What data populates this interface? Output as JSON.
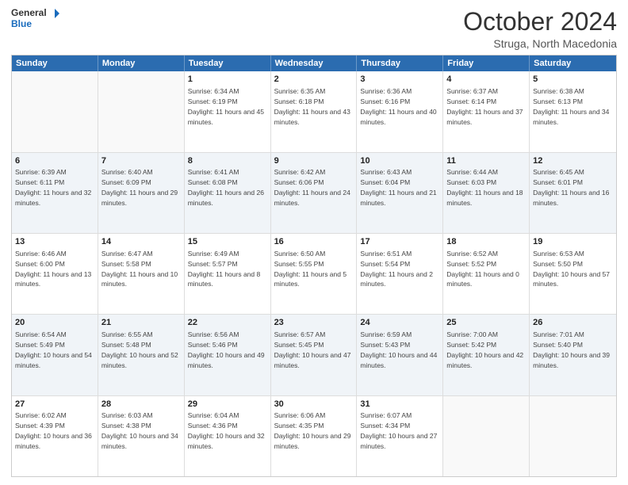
{
  "header": {
    "logo": {
      "general": "General",
      "blue": "Blue"
    },
    "title": "October 2024",
    "location": "Struga, North Macedonia"
  },
  "calendar": {
    "days": [
      "Sunday",
      "Monday",
      "Tuesday",
      "Wednesday",
      "Thursday",
      "Friday",
      "Saturday"
    ],
    "rows": [
      [
        {
          "day": "",
          "empty": true
        },
        {
          "day": "",
          "empty": true
        },
        {
          "day": "1",
          "sunrise": "Sunrise: 6:34 AM",
          "sunset": "Sunset: 6:19 PM",
          "daylight": "Daylight: 11 hours and 45 minutes."
        },
        {
          "day": "2",
          "sunrise": "Sunrise: 6:35 AM",
          "sunset": "Sunset: 6:18 PM",
          "daylight": "Daylight: 11 hours and 43 minutes."
        },
        {
          "day": "3",
          "sunrise": "Sunrise: 6:36 AM",
          "sunset": "Sunset: 6:16 PM",
          "daylight": "Daylight: 11 hours and 40 minutes."
        },
        {
          "day": "4",
          "sunrise": "Sunrise: 6:37 AM",
          "sunset": "Sunset: 6:14 PM",
          "daylight": "Daylight: 11 hours and 37 minutes."
        },
        {
          "day": "5",
          "sunrise": "Sunrise: 6:38 AM",
          "sunset": "Sunset: 6:13 PM",
          "daylight": "Daylight: 11 hours and 34 minutes."
        }
      ],
      [
        {
          "day": "6",
          "sunrise": "Sunrise: 6:39 AM",
          "sunset": "Sunset: 6:11 PM",
          "daylight": "Daylight: 11 hours and 32 minutes."
        },
        {
          "day": "7",
          "sunrise": "Sunrise: 6:40 AM",
          "sunset": "Sunset: 6:09 PM",
          "daylight": "Daylight: 11 hours and 29 minutes."
        },
        {
          "day": "8",
          "sunrise": "Sunrise: 6:41 AM",
          "sunset": "Sunset: 6:08 PM",
          "daylight": "Daylight: 11 hours and 26 minutes."
        },
        {
          "day": "9",
          "sunrise": "Sunrise: 6:42 AM",
          "sunset": "Sunset: 6:06 PM",
          "daylight": "Daylight: 11 hours and 24 minutes."
        },
        {
          "day": "10",
          "sunrise": "Sunrise: 6:43 AM",
          "sunset": "Sunset: 6:04 PM",
          "daylight": "Daylight: 11 hours and 21 minutes."
        },
        {
          "day": "11",
          "sunrise": "Sunrise: 6:44 AM",
          "sunset": "Sunset: 6:03 PM",
          "daylight": "Daylight: 11 hours and 18 minutes."
        },
        {
          "day": "12",
          "sunrise": "Sunrise: 6:45 AM",
          "sunset": "Sunset: 6:01 PM",
          "daylight": "Daylight: 11 hours and 16 minutes."
        }
      ],
      [
        {
          "day": "13",
          "sunrise": "Sunrise: 6:46 AM",
          "sunset": "Sunset: 6:00 PM",
          "daylight": "Daylight: 11 hours and 13 minutes."
        },
        {
          "day": "14",
          "sunrise": "Sunrise: 6:47 AM",
          "sunset": "Sunset: 5:58 PM",
          "daylight": "Daylight: 11 hours and 10 minutes."
        },
        {
          "day": "15",
          "sunrise": "Sunrise: 6:49 AM",
          "sunset": "Sunset: 5:57 PM",
          "daylight": "Daylight: 11 hours and 8 minutes."
        },
        {
          "day": "16",
          "sunrise": "Sunrise: 6:50 AM",
          "sunset": "Sunset: 5:55 PM",
          "daylight": "Daylight: 11 hours and 5 minutes."
        },
        {
          "day": "17",
          "sunrise": "Sunrise: 6:51 AM",
          "sunset": "Sunset: 5:54 PM",
          "daylight": "Daylight: 11 hours and 2 minutes."
        },
        {
          "day": "18",
          "sunrise": "Sunrise: 6:52 AM",
          "sunset": "Sunset: 5:52 PM",
          "daylight": "Daylight: 11 hours and 0 minutes."
        },
        {
          "day": "19",
          "sunrise": "Sunrise: 6:53 AM",
          "sunset": "Sunset: 5:50 PM",
          "daylight": "Daylight: 10 hours and 57 minutes."
        }
      ],
      [
        {
          "day": "20",
          "sunrise": "Sunrise: 6:54 AM",
          "sunset": "Sunset: 5:49 PM",
          "daylight": "Daylight: 10 hours and 54 minutes."
        },
        {
          "day": "21",
          "sunrise": "Sunrise: 6:55 AM",
          "sunset": "Sunset: 5:48 PM",
          "daylight": "Daylight: 10 hours and 52 minutes."
        },
        {
          "day": "22",
          "sunrise": "Sunrise: 6:56 AM",
          "sunset": "Sunset: 5:46 PM",
          "daylight": "Daylight: 10 hours and 49 minutes."
        },
        {
          "day": "23",
          "sunrise": "Sunrise: 6:57 AM",
          "sunset": "Sunset: 5:45 PM",
          "daylight": "Daylight: 10 hours and 47 minutes."
        },
        {
          "day": "24",
          "sunrise": "Sunrise: 6:59 AM",
          "sunset": "Sunset: 5:43 PM",
          "daylight": "Daylight: 10 hours and 44 minutes."
        },
        {
          "day": "25",
          "sunrise": "Sunrise: 7:00 AM",
          "sunset": "Sunset: 5:42 PM",
          "daylight": "Daylight: 10 hours and 42 minutes."
        },
        {
          "day": "26",
          "sunrise": "Sunrise: 7:01 AM",
          "sunset": "Sunset: 5:40 PM",
          "daylight": "Daylight: 10 hours and 39 minutes."
        }
      ],
      [
        {
          "day": "27",
          "sunrise": "Sunrise: 6:02 AM",
          "sunset": "Sunset: 4:39 PM",
          "daylight": "Daylight: 10 hours and 36 minutes."
        },
        {
          "day": "28",
          "sunrise": "Sunrise: 6:03 AM",
          "sunset": "Sunset: 4:38 PM",
          "daylight": "Daylight: 10 hours and 34 minutes."
        },
        {
          "day": "29",
          "sunrise": "Sunrise: 6:04 AM",
          "sunset": "Sunset: 4:36 PM",
          "daylight": "Daylight: 10 hours and 32 minutes."
        },
        {
          "day": "30",
          "sunrise": "Sunrise: 6:06 AM",
          "sunset": "Sunset: 4:35 PM",
          "daylight": "Daylight: 10 hours and 29 minutes."
        },
        {
          "day": "31",
          "sunrise": "Sunrise: 6:07 AM",
          "sunset": "Sunset: 4:34 PM",
          "daylight": "Daylight: 10 hours and 27 minutes."
        },
        {
          "day": "",
          "empty": true
        },
        {
          "day": "",
          "empty": true
        }
      ]
    ]
  }
}
